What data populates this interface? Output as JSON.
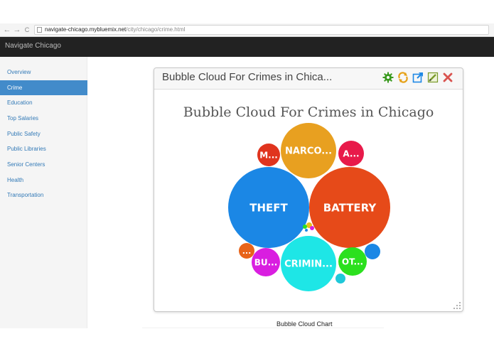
{
  "browser": {
    "back": "←",
    "forward": "→",
    "reload": "C",
    "url_host": "navigate-chicago.mybluemix.net",
    "url_path": "/city/chicago/crime.html"
  },
  "app": {
    "brand": "Navigate Chicago"
  },
  "sidebar": {
    "items": [
      {
        "label": "Overview"
      },
      {
        "label": "Crime"
      },
      {
        "label": "Education"
      },
      {
        "label": "Top Salaries"
      },
      {
        "label": "Public Safety"
      },
      {
        "label": "Public Libraries"
      },
      {
        "label": "Senior Centers"
      },
      {
        "label": "Health"
      },
      {
        "label": "Transportation"
      }
    ],
    "active_index": 1
  },
  "widget": {
    "header_title": "Bubble Cloud For Crimes in Chica...",
    "tools": [
      "gear-icon",
      "refresh-icon",
      "external-link-icon",
      "edit-icon",
      "close-icon"
    ],
    "tool_colors": {
      "gear": "#3a9a1f",
      "refresh": "#e6a21a",
      "external": "#1e88e5",
      "edit": "#7a9a2a",
      "close": "#d9534f"
    }
  },
  "chart_data": {
    "type": "bubble",
    "title": "Bubble Cloud For Crimes in Chicago",
    "bubbles": [
      {
        "label": "THEFT",
        "color": "#1b87e5"
      },
      {
        "label": "BATTERY",
        "color": "#e64a19"
      },
      {
        "label": "NARCO...",
        "color": "#e8a020"
      },
      {
        "label": "CRIMIN...",
        "color": "#1ee6e6"
      },
      {
        "label": "M...",
        "color": "#e0341e"
      },
      {
        "label": "A...",
        "color": "#e81a4a"
      },
      {
        "label": "BU...",
        "color": "#d91ee0"
      },
      {
        "label": "OT...",
        "color": "#2be01e"
      },
      {
        "label": "...",
        "color": "#e8641a"
      },
      {
        "label": "",
        "color": "#1b87e5"
      },
      {
        "label": "",
        "color": "#1ec8d9"
      },
      {
        "label": "",
        "color": "#e8c01a"
      },
      {
        "label": "",
        "color": "#2be01e"
      },
      {
        "label": "",
        "color": "#d91ee0"
      },
      {
        "label": "",
        "color": "#1b87e5"
      }
    ]
  },
  "footer": {
    "label": "Bubble Cloud Chart"
  }
}
